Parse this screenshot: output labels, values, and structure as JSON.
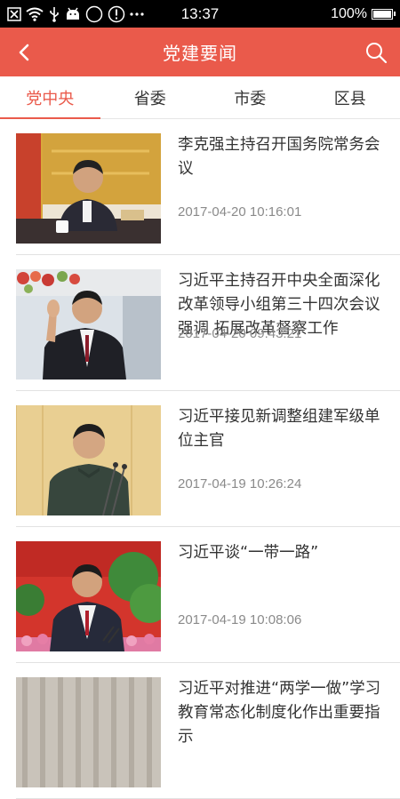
{
  "status_bar": {
    "time": "13:37",
    "battery": "100%",
    "battery_level": 1.0,
    "icons": [
      "close-box-icon",
      "wifi-icon",
      "usb-icon",
      "android-icon",
      "circle-icon",
      "alert-icon",
      "more-dots-icon"
    ]
  },
  "header": {
    "title": "党建要闻",
    "back_icon": "back-chevron-icon",
    "search_icon": "search-icon",
    "color": "#ea5a4b"
  },
  "tabs": [
    {
      "label": "党中央",
      "active": true
    },
    {
      "label": "省委",
      "active": false
    },
    {
      "label": "市委",
      "active": false
    },
    {
      "label": "区县",
      "active": false
    }
  ],
  "news": [
    {
      "title": "李克强主持召开国务院常务会议",
      "time": "2017-04-20 10:16:01"
    },
    {
      "title": "习近平主持召开中央全面深化改革领导小组第三十四次会议强调 拓展改革督察工作",
      "time": "2017-04-20 09:43:21"
    },
    {
      "title": "习近平接见新调整组建军级单位主官",
      "time": "2017-04-19 10:26:24"
    },
    {
      "title": "习近平谈“一带一路”",
      "time": "2017-04-19 10:08:06"
    },
    {
      "title": "习近平对推进“两学一做”学习教育常态化制度化作出重要指示",
      "time": ""
    }
  ]
}
